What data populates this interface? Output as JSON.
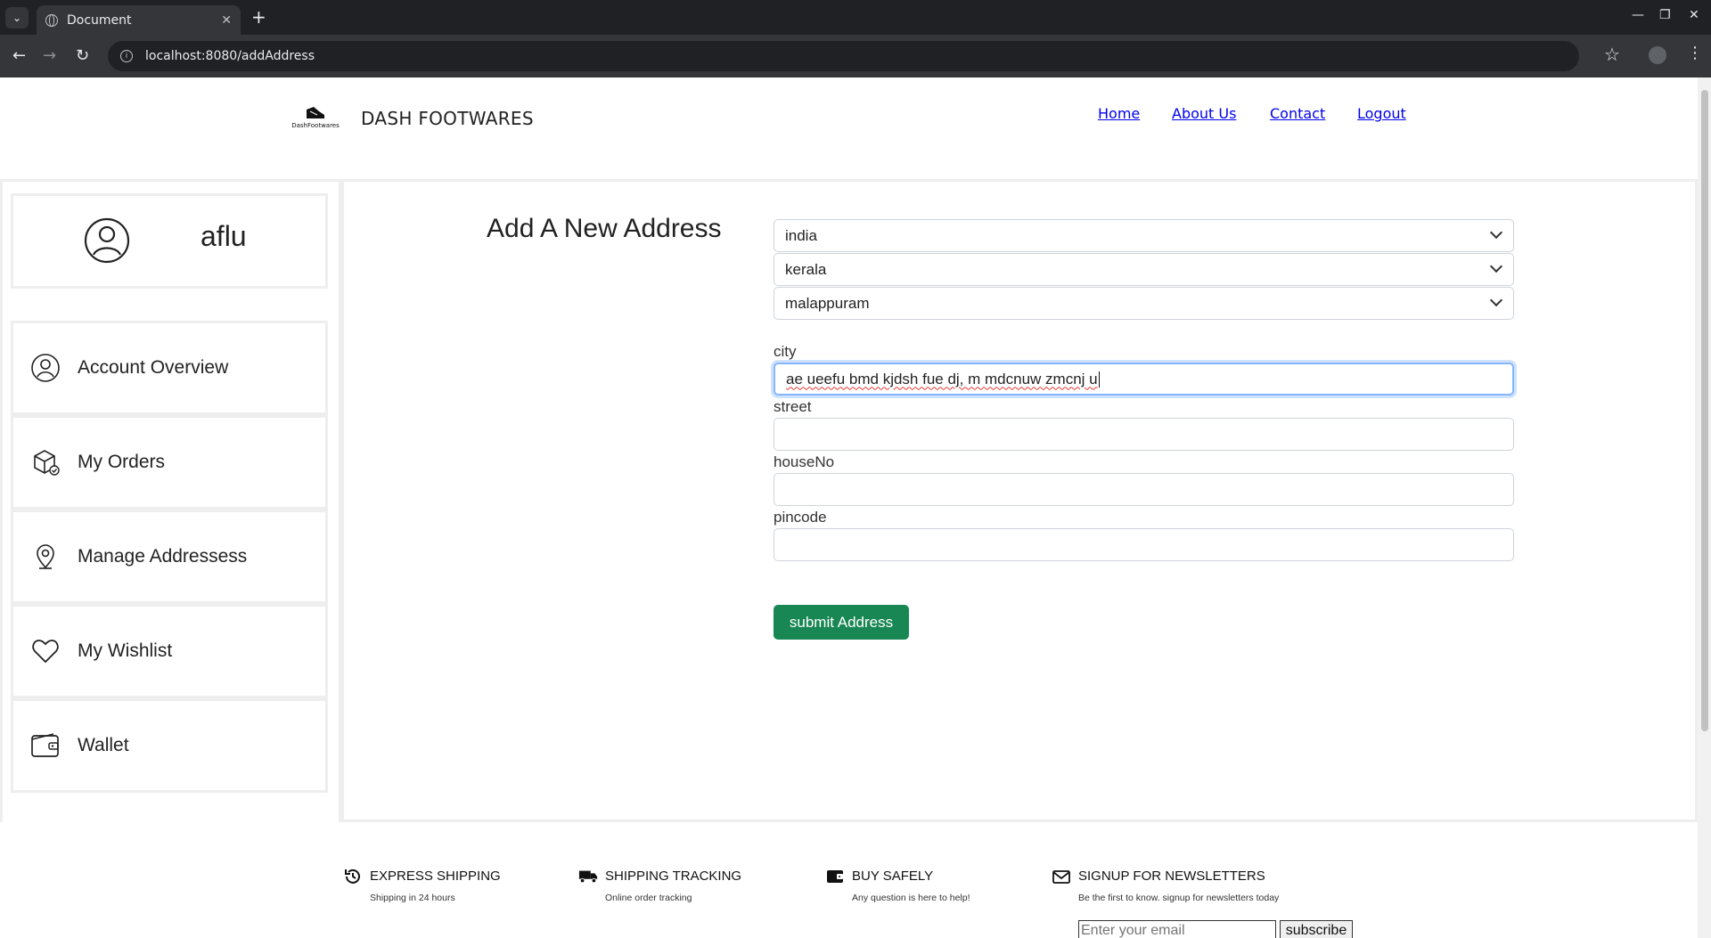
{
  "browser": {
    "tab_title": "Document",
    "url": "localhost:8080/addAddress"
  },
  "header": {
    "brand": "DASH FOOTWARES",
    "logo_text": "DashFootwares",
    "nav": [
      "Home",
      "About Us",
      "Contact",
      "Logout"
    ]
  },
  "profile": {
    "username": "aflu"
  },
  "sidebar": {
    "items": [
      {
        "label": "Account Overview",
        "icon": "user-circle-icon"
      },
      {
        "label": "My Orders",
        "icon": "package-icon"
      },
      {
        "label": "Manage Addressess",
        "icon": "map-pin-icon"
      },
      {
        "label": "My Wishlist",
        "icon": "heart-icon"
      },
      {
        "label": "Wallet",
        "icon": "wallet-icon"
      }
    ]
  },
  "form": {
    "title": "Add A New Address",
    "country": "india",
    "state": "kerala",
    "district": "malappuram",
    "city_label": "city",
    "city_value": "ae ueefu bmd kjdsh fue dj, m mdcnuw zmcnj u",
    "street_label": "street",
    "street_value": "",
    "houseno_label": "houseNo",
    "houseno_value": "",
    "pincode_label": "pincode",
    "pincode_value": "",
    "submit_label": "submit Address"
  },
  "footer": {
    "features": [
      {
        "title": "EXPRESS SHIPPING",
        "subtitle": "Shipping in 24 hours",
        "icon": "history-icon"
      },
      {
        "title": "SHIPPING TRACKING",
        "subtitle": "Online order tracking",
        "icon": "truck-icon"
      },
      {
        "title": "BUY SAFELY",
        "subtitle": "Any question is here to help!",
        "icon": "wallet-icon"
      },
      {
        "title": "SIGNUP FOR NEWSLETTERS",
        "subtitle": "Be the first to know. signup for newsletters today",
        "icon": "envelope-icon"
      }
    ],
    "email_placeholder": "Enter your email",
    "subscribe_label": "subscribe"
  },
  "colors": {
    "submit_bg": "#198754",
    "focus_ring": "#86b7fe",
    "chrome_dark": "#202124"
  }
}
